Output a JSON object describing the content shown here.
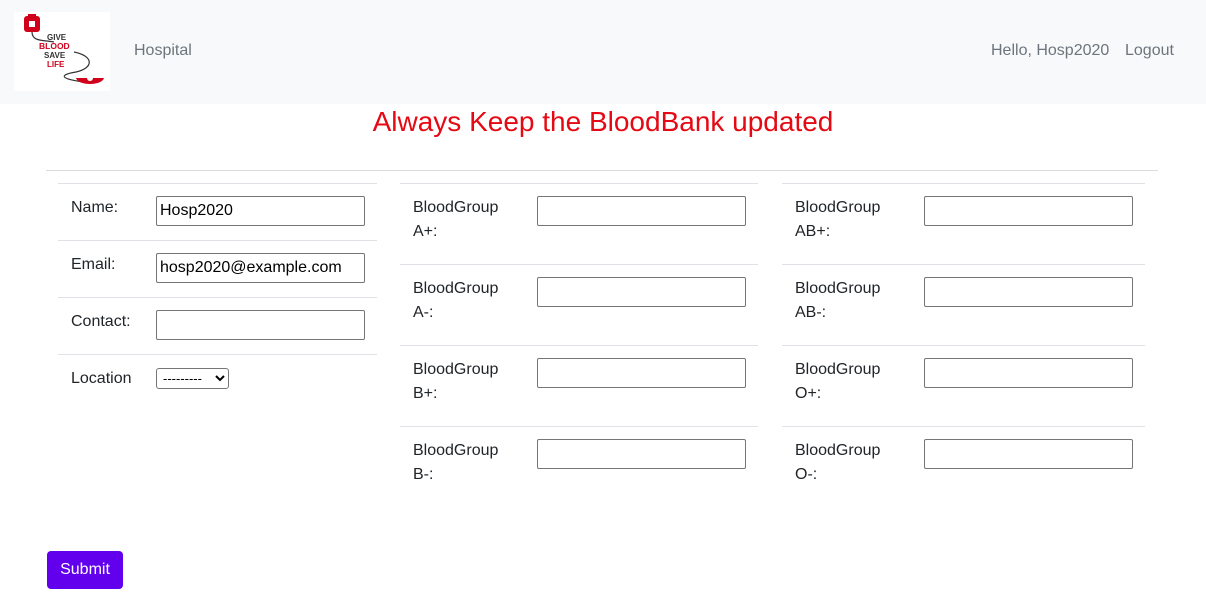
{
  "navbar": {
    "logo_alt_text": "GIVE BLOOD SAVE LIFE",
    "brand": "Hospital",
    "greeting": "Hello, Hosp2020",
    "logout": "Logout"
  },
  "heading": "Always Keep the BloodBank updated",
  "colors": {
    "heading": "#e50914",
    "submit": "#6200ee",
    "navbar_bg": "#f8f9fa",
    "link": "#6c757d"
  },
  "profile": {
    "name_label": "Name:",
    "name_value": "Hosp2020",
    "email_label": "Email:",
    "email_value": "hosp2020@example.com",
    "contact_label": "Contact:",
    "contact_value": "",
    "location_label": "Location",
    "location_selected": "---------"
  },
  "blood": {
    "a_pos": {
      "line1": "BloodGroup",
      "line2": "A+:",
      "value": ""
    },
    "a_neg": {
      "line1": "BloodGroup",
      "line2": "A-:",
      "value": ""
    },
    "b_pos": {
      "line1": "BloodGroup",
      "line2": "B+:",
      "value": ""
    },
    "b_neg": {
      "line1": "BloodGroup",
      "line2": "B-:",
      "value": ""
    },
    "ab_pos": {
      "line1": "BloodGroup",
      "line2": "AB+:",
      "value": ""
    },
    "ab_neg": {
      "line1": "BloodGroup",
      "line2": "AB-:",
      "value": ""
    },
    "o_pos": {
      "line1": "BloodGroup",
      "line2": "O+:",
      "value": ""
    },
    "o_neg": {
      "line1": "BloodGroup",
      "line2": "O-:",
      "value": ""
    }
  },
  "submit_label": "Submit"
}
